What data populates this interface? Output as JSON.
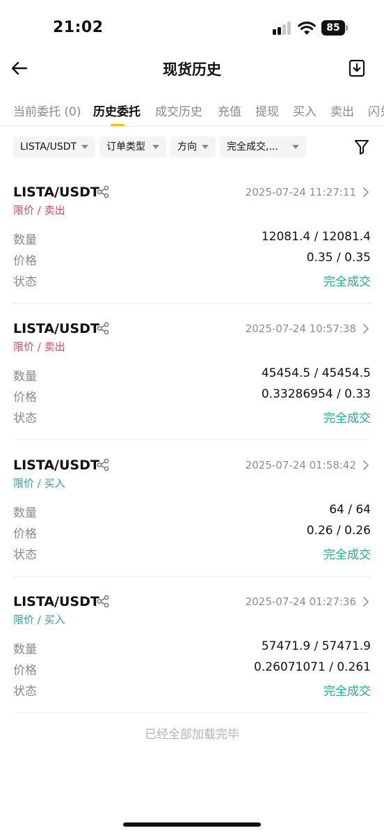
{
  "status_bar": {
    "time": "21:02",
    "battery": "85"
  },
  "header": {
    "title": "现货历史"
  },
  "tabs": [
    {
      "label": "当前委托 (0)",
      "active": false
    },
    {
      "label": "历史委托",
      "active": true
    },
    {
      "label": "成交历史",
      "active": false
    },
    {
      "label": "充值",
      "active": false
    },
    {
      "label": "提现",
      "active": false
    },
    {
      "label": "买入",
      "active": false
    },
    {
      "label": "卖出",
      "active": false
    },
    {
      "label": "闪兑",
      "active": false
    }
  ],
  "filters": [
    {
      "label": "LISTA/USDT"
    },
    {
      "label": "订单类型"
    },
    {
      "label": "方向"
    },
    {
      "label": "完全成交,..."
    }
  ],
  "row_labels": {
    "quantity": "数量",
    "price": "价格",
    "status": "状态"
  },
  "orders": [
    {
      "pair": "LISTA/USDT",
      "time": "2025-07-24 11:27:11",
      "type": "限价 / 卖出",
      "side": "sell",
      "quantity": "12081.4 / 12081.4",
      "price": "0.35 / 0.35",
      "status": "完全成交"
    },
    {
      "pair": "LISTA/USDT",
      "time": "2025-07-24 10:57:38",
      "type": "限价 / 卖出",
      "side": "sell",
      "quantity": "45454.5 / 45454.5",
      "price": "0.33286954 / 0.33",
      "status": "完全成交"
    },
    {
      "pair": "LISTA/USDT",
      "time": "2025-07-24 01:58:42",
      "type": "限价 / 买入",
      "side": "buy",
      "quantity": "64 / 64",
      "price": "0.26 / 0.26",
      "status": "完全成交"
    },
    {
      "pair": "LISTA/USDT",
      "time": "2025-07-24 01:27:36",
      "type": "限价 / 买入",
      "side": "buy",
      "quantity": "57471.9 / 57471.9",
      "price": "0.26071071 / 0.261",
      "status": "完全成交"
    }
  ],
  "footer": {
    "end_note": "已经全部加载完毕"
  },
  "colors": {
    "accent": "#f0c500",
    "sell": "#e04a5f",
    "buy": "#2aab8a",
    "muted": "#8a8a8a"
  },
  "icons": {
    "back": "arrow-left-icon",
    "download": "download-icon",
    "filter": "funnel-icon",
    "share": "share-icon",
    "chevron": "chevron-right-icon"
  }
}
